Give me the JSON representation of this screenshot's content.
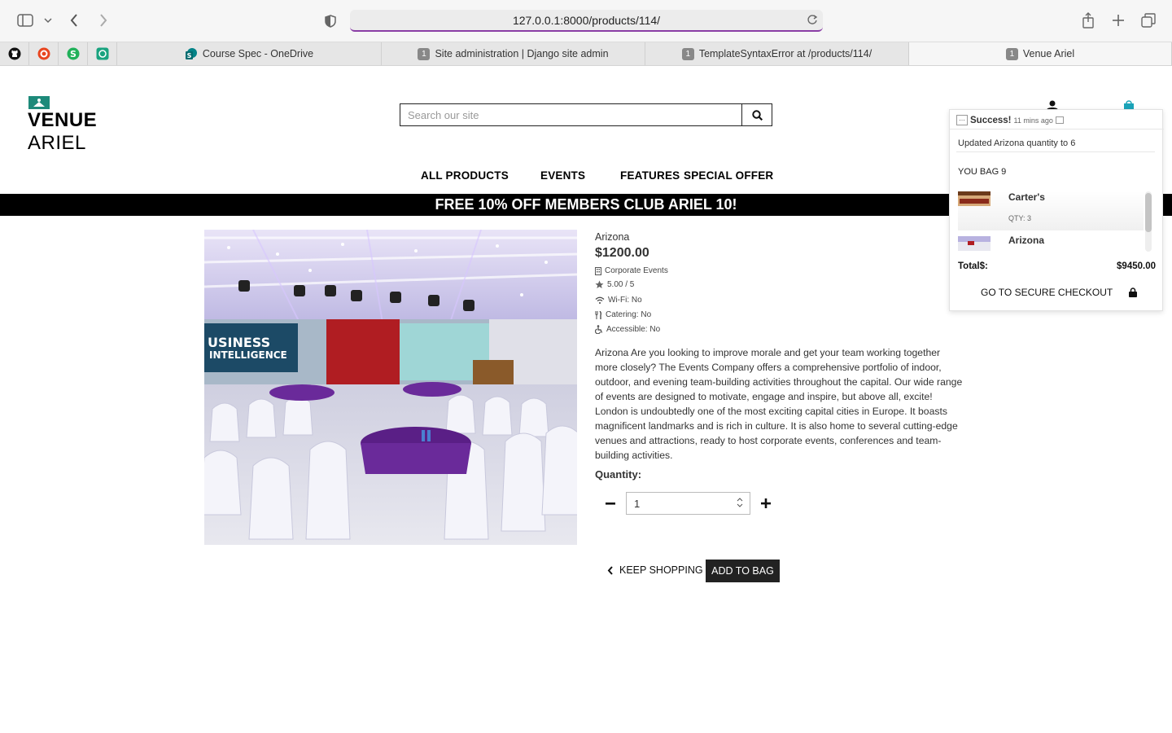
{
  "browser": {
    "url": "127.0.0.1:8000/products/114/",
    "tabs": [
      {
        "label": "Course Spec - OneDrive",
        "badge": ""
      },
      {
        "label": "Site administration | Django site admin",
        "badge": "1"
      },
      {
        "label": "TemplateSyntaxError at /products/114/",
        "badge": "1"
      },
      {
        "label": "Venue Ariel",
        "badge": "1"
      }
    ]
  },
  "site": {
    "logo_line1": "VENUE",
    "logo_line2": "ARIEL",
    "search_placeholder": "Search our site",
    "nav": [
      "ALL PRODUCTS",
      "EVENTS",
      "FEATURES",
      "SPECIAL OFFER"
    ],
    "banner": "FREE 10% OFF MEMBERS CLUB ARIEL 10!"
  },
  "product": {
    "name": "Arizona",
    "price": "$1200.00",
    "category": "Corporate Events",
    "rating": "5.00 / 5",
    "wifi": "Wi-Fi: No",
    "catering": "Catering: No",
    "accessible": "Accessible: No",
    "description": "Arizona Are you looking to improve morale and get your team working together more closely? The Events Company offers a comprehensive portfolio of indoor, outdoor, and evening team-building activities throughout the capital. Our wide range of events are designed to motivate, engage and inspire, but above all, excite! London is undoubtedly one of the most exciting capital cities in Europe. It boasts magnificent landmarks and is rich in culture. It is also home to several cutting-edge venues and attractions, ready to host corporate events, conferences and team-building activities.",
    "quantity_label": "Quantity:",
    "quantity_value": "1",
    "keep_shopping": "KEEP SHOPPING",
    "add_to_bag": "ADD TO BAG"
  },
  "toast": {
    "title": "Success!",
    "time": "11 mins ago",
    "message": "Updated Arizona quantity to 6",
    "bag_label": "YOU BAG 9",
    "items": [
      {
        "name": "Carter's",
        "qty": "QTY: 3"
      },
      {
        "name": "Arizona",
        "qty": ""
      }
    ],
    "total_label": "Total$:",
    "total_value": "$9450.00",
    "checkout": "GO TO SECURE CHECKOUT"
  },
  "colors": {
    "brand": "#1d8a7a",
    "banner": "#000000",
    "accent_url": "#8a3ea6"
  }
}
